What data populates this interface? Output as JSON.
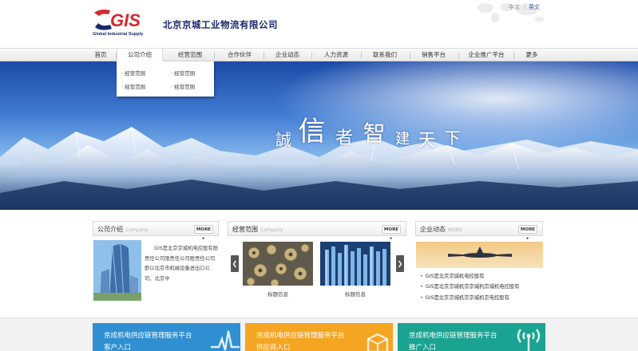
{
  "header": {
    "logo_text": "GIS",
    "logo_subtitle": "Global Industrial Supply",
    "company_name": "北京京城工业物流有限公司",
    "lang_cn": "中文",
    "lang_separator": "|",
    "lang_en": "英文"
  },
  "nav": {
    "items": [
      {
        "label": "首页"
      },
      {
        "label": "公司介绍",
        "active": true
      },
      {
        "label": "经营范围"
      },
      {
        "label": "合作伙伴"
      },
      {
        "label": "企业动态"
      },
      {
        "label": "人力资源"
      },
      {
        "label": "联系我们"
      },
      {
        "label": "销售平台"
      },
      {
        "label": "企业推广平台"
      },
      {
        "label": "更多"
      }
    ],
    "dropdown": [
      "经营范围",
      "经营范围",
      "经营范围",
      "经营范围"
    ]
  },
  "banner": {
    "slogan": [
      "誠",
      "信",
      "者",
      "智",
      "建",
      "天",
      "下"
    ]
  },
  "panels": {
    "about": {
      "title": "公司介绍",
      "title_en": "Company",
      "more": "MORE",
      "text": "GIS是北京京城机电控股有限责任公司限责任公司限责任公司即以北京市机械设备进出口公司、北京中"
    },
    "business": {
      "title": "经营范围",
      "title_en": "Company",
      "more": "MORE",
      "products": [
        {
          "caption": "标题信息"
        },
        {
          "caption": "标题信息"
        }
      ],
      "prev": "❮",
      "next": "❯"
    },
    "news": {
      "title": "企业动态",
      "title_en": "NEWS",
      "more": "MORE",
      "items": [
        "GIS是北京京城机电控股有",
        "GIS是北京京城机京京城机京城机电控股有",
        "GIS是北京京城机京京城机京电控股有"
      ]
    }
  },
  "entries": [
    {
      "title": "京成机电供应链管理服务平台",
      "sub": "客户入口",
      "color": "#2f8fd1"
    },
    {
      "title": "京成机电供应链管理服务平台",
      "sub": "供应商入口",
      "color": "#f4a522"
    },
    {
      "title": "京成机电供应链管理服务平台",
      "sub": "推广入口",
      "color": "#1aa391"
    }
  ],
  "colors": {
    "brand_red": "#d7262e",
    "brand_navy": "#1a2a6c",
    "nav_bg": "#eeeeee"
  }
}
